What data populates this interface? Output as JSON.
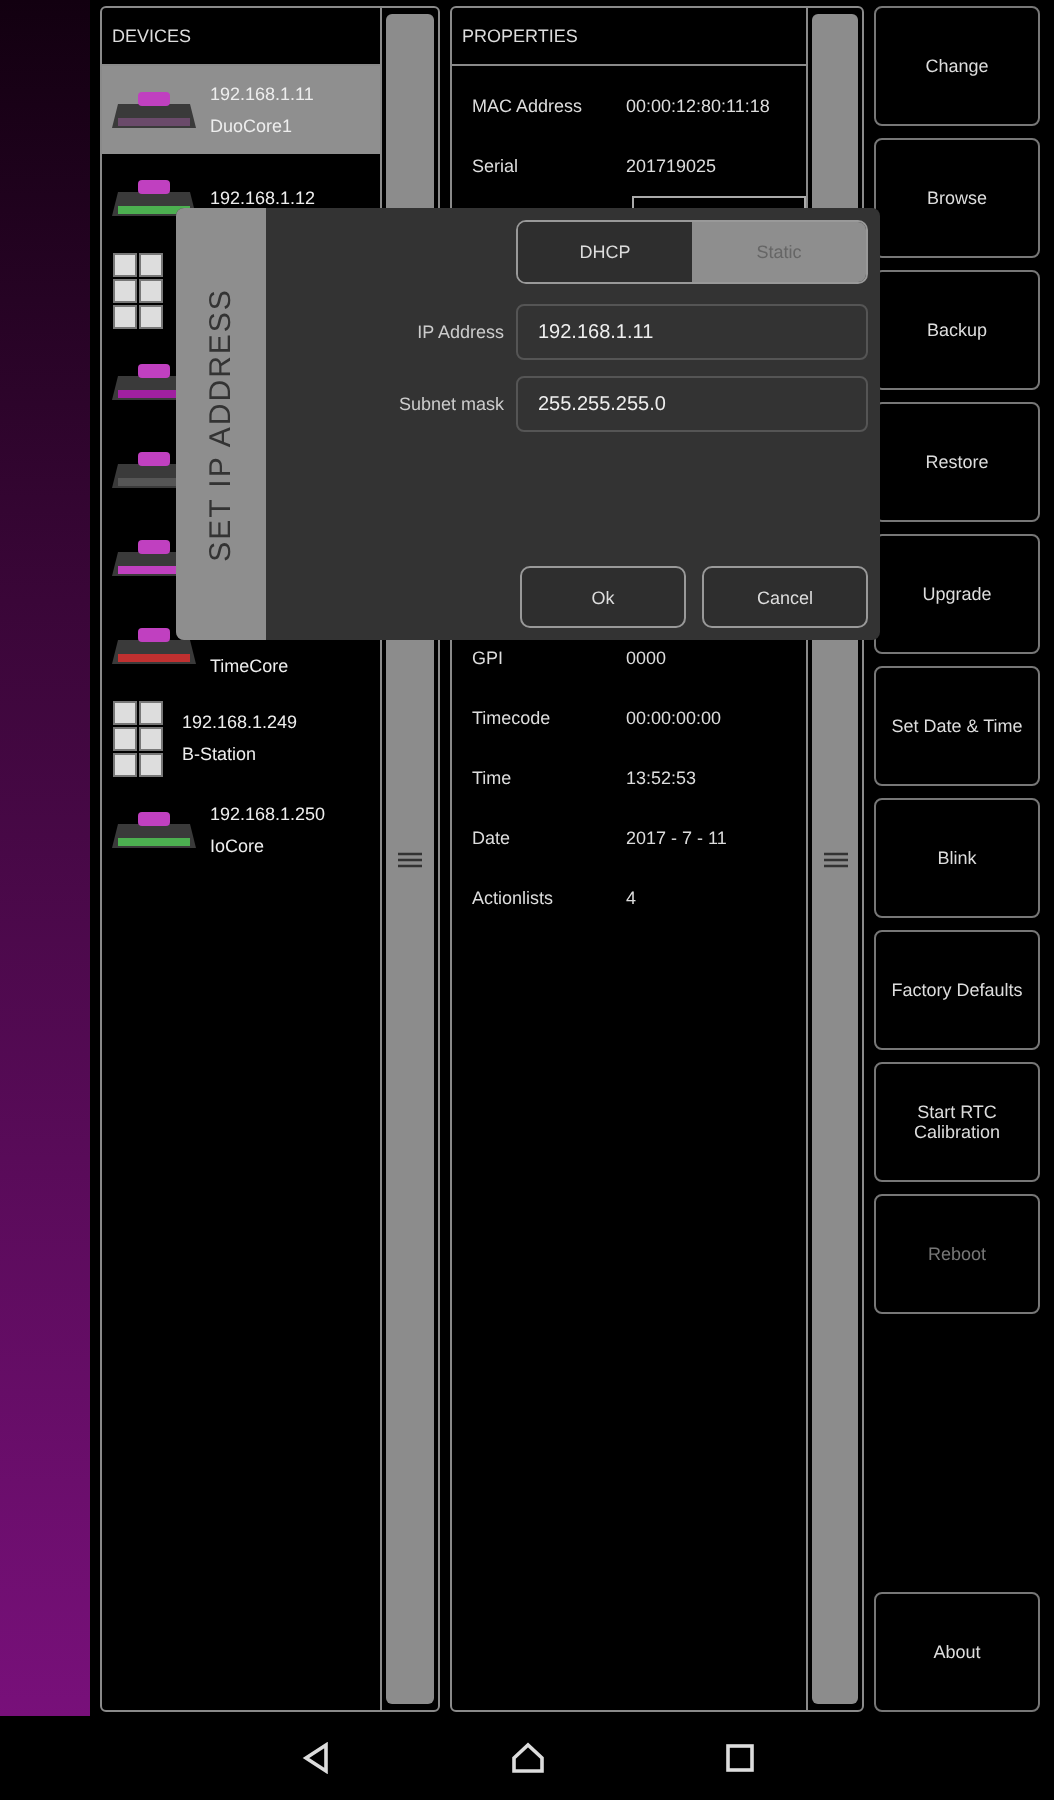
{
  "devices": {
    "title": "DEVICES",
    "items": [
      {
        "kind": "unit",
        "ip": "192.168.1.11",
        "name": "DuoCore1",
        "selected": true,
        "color": "#6a4a6a"
      },
      {
        "kind": "unit",
        "ip": "192.168.1.12",
        "selected": false,
        "color": "#4caf50"
      },
      {
        "kind": "stack",
        "selected": false
      },
      {
        "kind": "unit",
        "selected": false,
        "color": "#a020a0"
      },
      {
        "kind": "unit",
        "selected": false,
        "color": "#555555"
      },
      {
        "kind": "unit",
        "selected": false,
        "color": "#c040c0"
      },
      {
        "kind": "unit",
        "name": "TimeCore",
        "selected": false,
        "color": "#c03030"
      },
      {
        "kind": "stack",
        "ip": "192.168.1.249",
        "name": "B-Station",
        "selected": false
      },
      {
        "kind": "unit",
        "ip": "192.168.1.250",
        "name": "IoCore",
        "selected": false,
        "color": "#4caf50"
      }
    ]
  },
  "properties": {
    "title": "PROPERTIES",
    "top_rows": [
      {
        "label": "MAC Address",
        "value": "00:00:12:80:11:18"
      },
      {
        "label": "Serial",
        "value": "201719025"
      }
    ],
    "bottom_rows": [
      {
        "label": "GPI",
        "value": "0000"
      },
      {
        "label": "Timecode",
        "value": "00:00:00:00"
      },
      {
        "label": "Time",
        "value": "13:52:53"
      },
      {
        "label": "Date",
        "value": "2017 - 7 - 11"
      },
      {
        "label": "Actionlists",
        "value": "4"
      }
    ]
  },
  "actions": [
    {
      "label": "Change",
      "disabled": false
    },
    {
      "label": "Browse",
      "disabled": false
    },
    {
      "label": "Backup",
      "disabled": false
    },
    {
      "label": "Restore",
      "disabled": false
    },
    {
      "label": "Upgrade",
      "disabled": false
    },
    {
      "label": "Set Date & Time",
      "disabled": false
    },
    {
      "label": "Blink",
      "disabled": false
    },
    {
      "label": "Factory Defaults",
      "disabled": false
    },
    {
      "label": "Start RTC Calibration",
      "disabled": false
    },
    {
      "label": "Reboot",
      "disabled": true
    }
  ],
  "about": {
    "label": "About",
    "disabled": false
  },
  "dialog": {
    "title": "SET IP ADDRESS",
    "modes": [
      {
        "label": "DHCP",
        "selected": true
      },
      {
        "label": "Static",
        "selected": false
      }
    ],
    "fields": [
      {
        "label": "IP Address",
        "value": "192.168.1.11"
      },
      {
        "label": "Subnet mask",
        "value": "255.255.255.0"
      }
    ],
    "buttons": [
      "Ok",
      "Cancel"
    ]
  }
}
